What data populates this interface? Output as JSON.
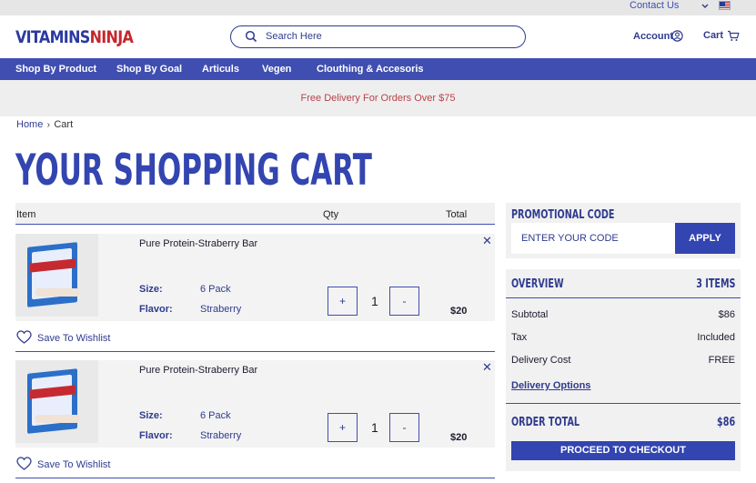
{
  "topbar": {
    "contact_label": "Contact Us"
  },
  "header": {
    "logo_part1": "VITAMINS",
    "logo_part2": "NINJA",
    "search_placeholder": "Search Here",
    "account_label": "Account",
    "cart_label": "Cart"
  },
  "nav": {
    "items": [
      "Shop By Product",
      "Shop By Goal",
      "Articuls",
      "Vegen",
      "Clouthing & Accesoris"
    ]
  },
  "banner": {
    "text": "Free Delivery For Orders Over $75"
  },
  "breadcrumb": {
    "home": "Home",
    "current": "Cart"
  },
  "page_title": "YOUR SHOPPING CART",
  "cart_table": {
    "headers": {
      "item": "Item",
      "qty": "Qty",
      "total": "Total"
    },
    "rows": [
      {
        "name": "Pure Protein-Straberry Bar",
        "size_label": "Size:",
        "size": "6 Pack",
        "flavor_label": "Flavor:",
        "flavor": "Straberry",
        "qty": "1",
        "total": "$20",
        "remove": "✕",
        "wishlist": "Save To Wishlist",
        "plus": "+",
        "minus": "-"
      },
      {
        "name": "Pure Protein-Straberry Bar",
        "size_label": "Size:",
        "size": "6 Pack",
        "flavor_label": "Flavor:",
        "flavor": "Straberry",
        "qty": "1",
        "total": "$20",
        "remove": "✕",
        "wishlist": "Save To Wishlist",
        "plus": "+",
        "minus": "-"
      }
    ]
  },
  "promo": {
    "title": "PROMOTIONAL CODE",
    "placeholder": "ENTER YOUR CODE",
    "apply": "APPLY"
  },
  "overview": {
    "title": "OVERVIEW",
    "items_count": "3 ITEMS",
    "subtotal_label": "Subtotal",
    "subtotal": "$86",
    "tax_label": "Tax",
    "tax": "Included",
    "delivery_label": "Delivery Cost",
    "delivery": "FREE",
    "delivery_options": "Delivery Options",
    "order_total_label": "ORDER TOTAL",
    "order_total": "$86",
    "checkout": "PROCEED TO CHECKOUT"
  },
  "colors": {
    "brand_blue": "#3f4eb0",
    "brand_red": "#c6262e",
    "banner_text": "#b8434a"
  },
  "icons": {
    "search": "search-icon",
    "account": "user-circle-icon",
    "cart": "cart-icon",
    "wishlist": "heart-icon",
    "remove": "close-icon",
    "language": "us-flag-icon"
  }
}
